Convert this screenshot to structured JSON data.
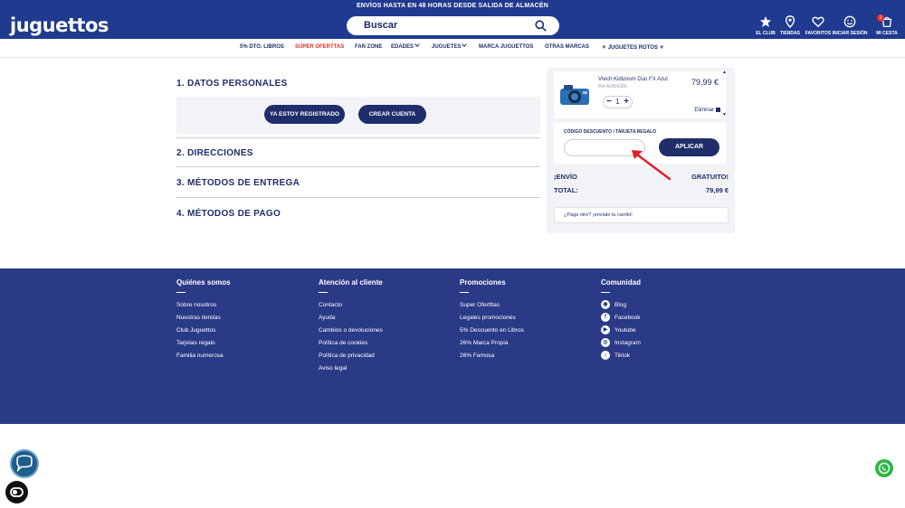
{
  "topbar": {
    "text": "ENVÍOS HASTA EN 48 HORAS DESDE SALIDA DE ALMACÉN"
  },
  "header": {
    "logo": "juguettos",
    "search_placeholder": "Buscar",
    "icons": [
      {
        "name": "star-icon",
        "label": "EL CLUB"
      },
      {
        "name": "location-icon",
        "label": "TIENDAS"
      },
      {
        "name": "heart-icon",
        "label": "FAVORITOS"
      },
      {
        "name": "smile-icon",
        "label": "INICIAR SESIÓN"
      },
      {
        "name": "cart-icon",
        "label": "MI CESTA",
        "badge": "1"
      }
    ]
  },
  "nav": {
    "items": [
      "5% DTO. LIBROS",
      "SÚPER OFERTTAS",
      "FAN ZONE",
      "EDADES",
      "JUGUETES",
      "MARCA JUGUETTOS",
      "OTRAS MARCAS",
      "JUGUETES ROTOS"
    ]
  },
  "checkout": {
    "section1": "1. DATOS PERSONALES",
    "btn_registered": "YA ESTOY REGISTRADO",
    "btn_create": "CREAR CUENTA",
    "section2": "2. DIRECCIONES",
    "section3": "3. MÉTODOS DE ENTREGA",
    "section4": "4. MÉTODOS DE PAGO"
  },
  "cart": {
    "product_name": "Vtech Kidizoom Duo FX Azul",
    "product_ref": "Ref A0406386",
    "price": "79,99 €",
    "quantity": "1",
    "remove": "Eliminar",
    "coupon_label": "CÓDIGO DESCUENTO / TARJETA REGALO",
    "coupon_value": "",
    "apply": "APLICAR",
    "shipping_label": "¡ENVÍO",
    "shipping_value": "GRATUITO!",
    "total_label": "TOTAL:",
    "total_value": "79,99 €",
    "gift_text": "¿Paga otro? ¡envíale tu carrito!"
  },
  "footer": {
    "columns": [
      {
        "title": "Quiénes somos",
        "links": [
          "Sobre nosotros",
          "Nuestras tiendas",
          "Club Juguettos",
          "Tarjetas regalo",
          "Familia numerosa"
        ]
      },
      {
        "title": "Atención al cliente",
        "links": [
          "Contacto",
          "Ayuda",
          "Cambios o devoluciones",
          "Política de cookies",
          "Política de privacidad",
          "Aviso legal"
        ]
      },
      {
        "title": "Promociones",
        "links": [
          "Super Ofertttas",
          "Legales promociones",
          "5% Descuento en Libros",
          "26% Marca Propia",
          "26% Famosa"
        ]
      },
      {
        "title": "Comunidad",
        "links": [
          "Blog",
          "Facebook",
          "Youtube",
          "Instagram",
          "Tiktok"
        ]
      }
    ]
  },
  "colors": {
    "brand_blue": "#1f3a8f",
    "navy": "#1f2d6b",
    "footer_blue": "#2a3a86",
    "accent_red": "#e7332b",
    "whatsapp_green": "#2cb742"
  }
}
